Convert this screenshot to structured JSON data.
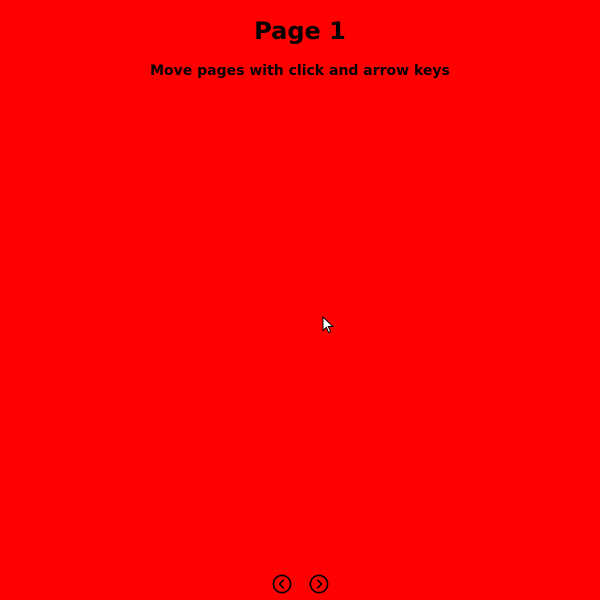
{
  "page": {
    "title": "Page 1",
    "instructions": "Move pages with click and arrow keys",
    "background_color": "#ff0000"
  },
  "navigation": {
    "previous_icon": "chevron-left-circle-icon",
    "next_icon": "chevron-right-circle-icon"
  },
  "cursor": {
    "icon": "mouse-pointer-icon"
  }
}
